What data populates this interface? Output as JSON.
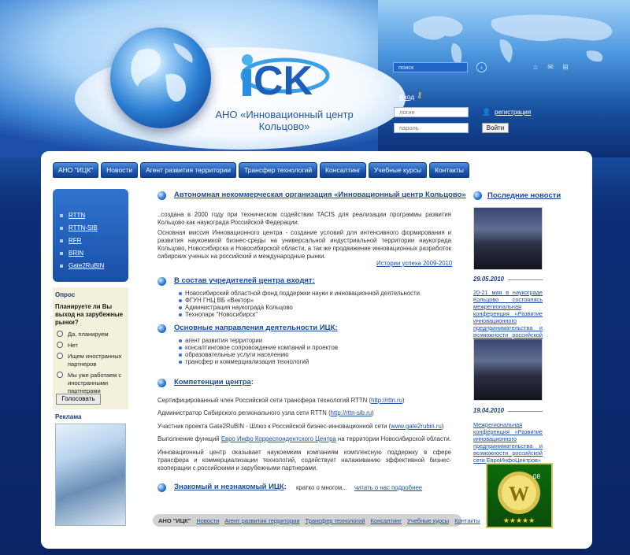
{
  "search": {
    "placeholder": "поиск",
    "go_icon": "arrow-right-icon"
  },
  "header": {
    "title": "АНО «Инновационный центр Кольцово»",
    "top_icons": [
      "home-icon",
      "mail-icon",
      "sitemap-icon"
    ]
  },
  "login": {
    "link": "Вход",
    "login_placeholder": "логин",
    "password_placeholder": "пароль",
    "register": "регистрация",
    "button": "Войти"
  },
  "nav": [
    "АНО \"ИЦК\"",
    "Новости",
    "Агент развития территории",
    "Трансфер технологий",
    "Консалтинг",
    "Учебные курсы",
    "Контакты"
  ],
  "sidebar": {
    "links": [
      "RTTN",
      "RTTN-SIB",
      "RFR",
      "BRIN",
      "Gate2RuBIN"
    ]
  },
  "poll": {
    "title": "Опрос",
    "question": "Планируете ли Вы выход на зарубежные рынки?",
    "options": [
      "Да, планируем",
      "Нет",
      "Ищем иностранных партнеров",
      "Мы уже работаем с иностранными партнерами"
    ],
    "button": "Голосовать"
  },
  "ads": {
    "title": "Реклама"
  },
  "main": {
    "title": "Автономная некоммерческая организация «Инновационный центр Кольцово»",
    "intro": "..создана в 2000 году при техническом содействии TACIS для реализации программы развития Кольцово как наукограда Российской Федерации.",
    "mission": "Основная миссия Инновационного центра - создание условий для интенсивного формирования и развития наукоемкой бизнес-среды на универсальной индустриальной территории наукограда Кольцово, Новосибирска и Новосибирской области, а так же продвижение инновационных разработок сибирских ученых на российский и международные рынки.",
    "history_link": "Истории успеха 2009-2010",
    "founders_title": "В состав учредителей центра входят:",
    "founders": [
      "Новосибирский областной фонд поддержки науки и инновационной деятельности",
      "ФГУН ГНЦ ВБ «Вектор»",
      "Администрация наукограда Кольцово",
      "Технопарк \"Новосибирск\""
    ],
    "directions_title": "Основные направления деятельности ИЦК:",
    "directions": [
      "агент развития территории",
      "консалтинговое сопровождение компаний и проектов",
      "образовательные услуги населению",
      "трансфер и коммерциализация технологий"
    ],
    "competence_title": "Компетенции центра",
    "competence_colon": ":",
    "comp1_text": "Сертифицированный член Российской сети трансфера технологий RTTN (",
    "comp1_link": "http://rttn.ru",
    "comp1_end": ")",
    "comp2_text": "Администратор Сибирского регионального узла сети RTTN (",
    "comp2_link": "http://rttn-sib.ru",
    "comp2_end": ")",
    "comp3_text": "Участник проекта Gate2RuBIN - Шлюз к Российской бизнес-инновационной сети (",
    "comp3_link": "www.gate2rubin.ru",
    "comp3_end": ")",
    "comp4_text": "Выполнение функций ",
    "comp4_link": "Евро Инфо Корреспондентского Центра",
    "comp4_end": " на территории Новосибирской области.",
    "comp5": "Инновационный центр оказывает наукоемким компаниям комплексную поддержку в сфере трансфера и коммерциализации технологий, содействует налаживанию эффективной бизнес-кооперации с российскими и зарубежными партнерами.",
    "familiar_title": "Знакомый и незнакомый ИЦК",
    "familiar_colon": ":",
    "familiar_text": "кратко о многом...",
    "familiar_link": "читать о нас подробнее"
  },
  "footer": [
    "АНО \"ИЦК\"",
    "Новости",
    "Агент развития территории",
    "Трансфер технологий",
    "Консалтинг",
    "Учебные курсы",
    "Контакты"
  ],
  "news": {
    "title": "Последние новости",
    "items": [
      {
        "date": "29.05.2010",
        "text": "20-21 мая в наукограде Кольцово состоялась межрегиональная конференция «Развитие инновационного предпринимательства и возможности российской сети Евро-ИнфоЦентров»"
      },
      {
        "date": "19.04.2010",
        "text": "Межрегиональная конференция «Развитие инновационного предпринимательства и возможности российской сети ЕвроИнфоЦентров»"
      }
    ]
  },
  "badge": {
    "number": "08"
  },
  "colors": {
    "accent": "#1a4a98",
    "nav_blue": "#1d59b4",
    "panel": "#ffffff"
  }
}
